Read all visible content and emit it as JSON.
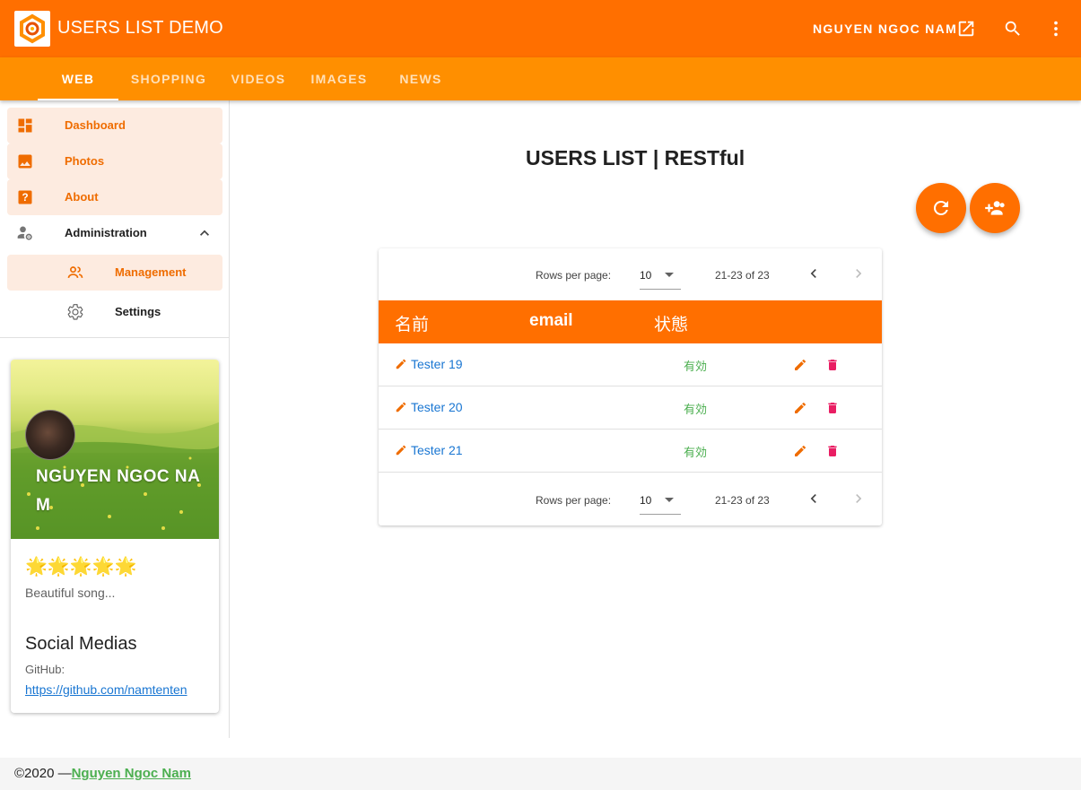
{
  "app": {
    "title": "USERS LIST DEMO",
    "user_name": "NGUYEN NGOC NAM"
  },
  "tabs": [
    {
      "label": "WEB",
      "active": true
    },
    {
      "label": "SHOPPING"
    },
    {
      "label": "VIDEOS"
    },
    {
      "label": "IMAGES"
    },
    {
      "label": "NEWS"
    }
  ],
  "sidebar": {
    "items": [
      {
        "label": "Dashboard",
        "icon": "dashboard-icon"
      },
      {
        "label": "Photos",
        "icon": "image-icon"
      },
      {
        "label": "About",
        "icon": "help-icon"
      },
      {
        "label": "Administration",
        "icon": "admin-settings-icon",
        "expanded": true
      },
      {
        "label": "Management",
        "icon": "people-icon"
      },
      {
        "label": "Settings",
        "icon": "gear-icon"
      }
    ]
  },
  "profile": {
    "name": "NGUYEN NGOC NAM",
    "stars": "🌟🌟🌟🌟🌟",
    "song": "Beautiful song...",
    "social_title": "Social Medias",
    "github_label": "GitHub:",
    "github_url": "https://github.com/namtenten"
  },
  "main": {
    "page_title": "USERS LIST | RESTful",
    "pagination": {
      "rows_per_page_label": "Rows per page:",
      "rows_per_page": "10",
      "range": "21-23 of 23"
    },
    "columns": [
      "名前",
      "email",
      "状態"
    ],
    "rows": [
      {
        "name": "Tester 19",
        "status": "有効"
      },
      {
        "name": "Tester 20",
        "status": "有効"
      },
      {
        "name": "Tester 21",
        "status": "有効"
      }
    ]
  },
  "footer": {
    "copyright": "©2020 —",
    "author": "Nguyen Ngoc Nam"
  },
  "colors": {
    "primary": "#ff6f00",
    "tabs": "#ff8f00",
    "highlight": "#fdebe0",
    "active_status": "#4caf50",
    "link": "#1976d2",
    "delete": "#e91e63"
  }
}
